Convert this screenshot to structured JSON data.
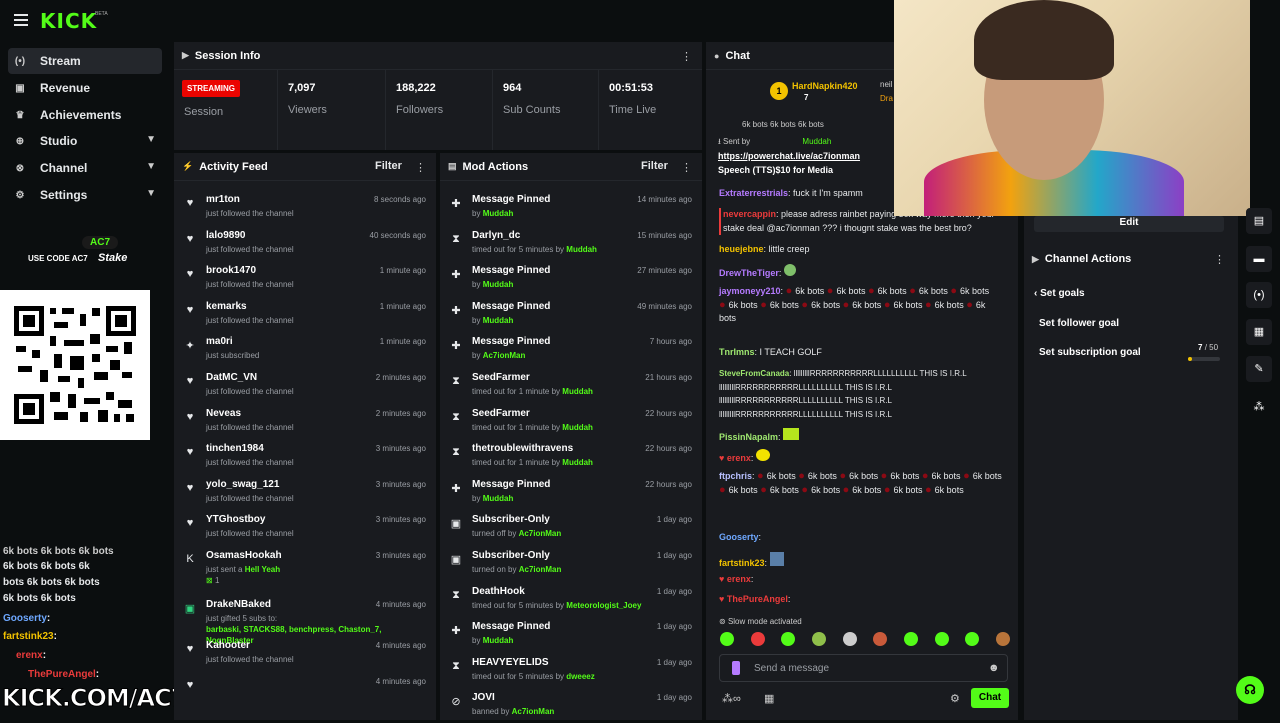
{
  "brand": {
    "logo": "KICK",
    "beta": "BETA"
  },
  "nav": [
    {
      "label": "Stream",
      "icon": "stream-icon"
    },
    {
      "label": "Revenue",
      "icon": "revenue-icon"
    },
    {
      "label": "Achievements",
      "icon": "trophy-icon"
    },
    {
      "label": "Studio",
      "icon": "studio-icon"
    },
    {
      "label": "Channel",
      "icon": "channel-icon"
    },
    {
      "label": "Settings",
      "icon": "gear-icon"
    }
  ],
  "promo": {
    "badge": "AC7",
    "code": "USE CODE AC7",
    "brand": "Stake"
  },
  "overlay_chat": {
    "lines": [
      {
        "text": "6k bots  6k bots  6k bots"
      },
      {
        "text": "6k bots  6k bots  6k"
      },
      {
        "text": "bots  6k bots  6k bots"
      },
      {
        "text": "6k bots  6k bots"
      },
      {
        "user": "Gooserty",
        "text": ":"
      },
      {
        "user": "fartstink23",
        "text": ":"
      },
      {
        "user": "erenx",
        "text": ":"
      },
      {
        "user": "ThePureAngel",
        "text": ":"
      }
    ],
    "url": "KICK.COM/AC7IONMAN"
  },
  "session": {
    "title": "Session Info",
    "badge": "STREAMING",
    "session_label": "Session",
    "stats": [
      {
        "value": "7,097",
        "label": "Viewers"
      },
      {
        "value": "188,222",
        "label": "Followers"
      },
      {
        "value": "964",
        "label": "Sub Counts"
      },
      {
        "value": "00:51:53",
        "label": "Time Live"
      }
    ]
  },
  "activity": {
    "title": "Activity Feed",
    "filter": "Filter",
    "items": [
      {
        "icon": "heart-icon",
        "name": "mr1ton",
        "sub": "just followed the channel",
        "time": "8 seconds ago"
      },
      {
        "icon": "heart-icon",
        "name": "lalo9890",
        "sub": "just followed the channel",
        "time": "40 seconds ago"
      },
      {
        "icon": "heart-icon",
        "name": "brook1470",
        "sub": "just followed the channel",
        "time": "1 minute ago"
      },
      {
        "icon": "heart-icon",
        "name": "kemarks",
        "sub": "just followed the channel",
        "time": "1 minute ago"
      },
      {
        "icon": "star-icon",
        "name": "ma0ri",
        "sub": "just subscribed",
        "time": "1 minute ago"
      },
      {
        "icon": "heart-icon",
        "name": "DatMC_VN",
        "sub": "just followed the channel",
        "time": "2 minutes ago"
      },
      {
        "icon": "heart-icon",
        "name": "Neveas",
        "sub": "just followed the channel",
        "time": "2 minutes ago"
      },
      {
        "icon": "heart-icon",
        "name": "tinchen1984",
        "sub": "just followed the channel",
        "time": "3 minutes ago"
      },
      {
        "icon": "heart-icon",
        "name": "yolo_swag_121",
        "sub": "just followed the channel",
        "time": "3 minutes ago"
      },
      {
        "icon": "heart-icon",
        "name": "YTGhostboy",
        "sub": "just followed the channel",
        "time": "3 minutes ago"
      },
      {
        "icon": "kick-icon",
        "name": "OsamasHookah",
        "sub": "just sent a",
        "sub_extra": "Hell Yeah",
        "sub2": "1",
        "time": "3 minutes ago"
      },
      {
        "icon": "gift-icon",
        "name": "DrakeNBaked",
        "sub": "just gifted 5 subs to:",
        "sub_list": "barbaski, STACKS88, benchpress, Chaston_7,",
        "sub_list2": "NognBlaster",
        "time": "4 minutes ago"
      },
      {
        "icon": "heart-icon",
        "name": "Kahooter",
        "sub": "just followed the channel",
        "time": "4 minutes ago"
      },
      {
        "icon": "heart-icon",
        "name": "",
        "sub": "",
        "time": "4 minutes ago"
      }
    ]
  },
  "mod": {
    "title": "Mod Actions",
    "filter": "Filter",
    "items": [
      {
        "icon": "pin-icon",
        "name": "Message Pinned",
        "pre": "by",
        "by": "Muddah",
        "time": "14 minutes ago"
      },
      {
        "icon": "hourglass-icon",
        "name": "Darlyn_dc",
        "pre": "timed out for 5 minutes by",
        "by": "Muddah",
        "time": "15 minutes ago"
      },
      {
        "icon": "pin-icon",
        "name": "Message Pinned",
        "pre": "by",
        "by": "Muddah",
        "time": "27 minutes ago"
      },
      {
        "icon": "pin-icon",
        "name": "Message Pinned",
        "pre": "by",
        "by": "Muddah",
        "time": "49 minutes ago"
      },
      {
        "icon": "pin-icon",
        "name": "Message Pinned",
        "pre": "by",
        "by": "Ac7ionMan",
        "time": "7 hours ago"
      },
      {
        "icon": "hourglass-icon",
        "name": "SeedFarmer",
        "pre": "timed out for 1 minute by",
        "by": "Muddah",
        "time": "21 hours ago"
      },
      {
        "icon": "hourglass-icon",
        "name": "SeedFarmer",
        "pre": "timed out for 1 minute by",
        "by": "Muddah",
        "time": "22 hours ago"
      },
      {
        "icon": "hourglass-icon",
        "name": "thetroublewithravens",
        "pre": "timed out for 1 minute by",
        "by": "Muddah",
        "time": "22 hours ago"
      },
      {
        "icon": "pin-icon",
        "name": "Message Pinned",
        "pre": "by",
        "by": "Muddah",
        "time": "22 hours ago"
      },
      {
        "icon": "gift-icon",
        "name": "Subscriber-Only",
        "pre": "turned off by",
        "by": "Ac7ionMan",
        "time": "1 day ago"
      },
      {
        "icon": "gift-icon",
        "name": "Subscriber-Only",
        "pre": "turned on by",
        "by": "Ac7ionMan",
        "time": "1 day ago"
      },
      {
        "icon": "hourglass-icon",
        "name": "DeathHook",
        "pre": "timed out for 5 minutes by",
        "by": "Meteorologist_Joey",
        "time": "1 day ago"
      },
      {
        "icon": "pin-icon",
        "name": "Message Pinned",
        "pre": "by",
        "by": "Muddah",
        "time": "1 day ago"
      },
      {
        "icon": "hourglass-icon",
        "name": "HEAVYEYELIDS",
        "pre": "timed out for 5 minutes by",
        "by": "dweeez",
        "time": "1 day ago"
      },
      {
        "icon": "ban-icon",
        "name": "JOVI",
        "pre": "banned by",
        "by": "Ac7ionMan",
        "time": "1 day ago"
      }
    ]
  },
  "chat": {
    "title": "Chat",
    "top_gifter": {
      "name": "HardNapkin420",
      "count": "7",
      "rank": "1"
    },
    "top_gifter2": "neil",
    "top_gifter3": "Dra",
    "pinned": {
      "header_bots": "6k bots   6k bots   6k bots",
      "sent_by_label": "Sent by",
      "sent_by": "Muddah",
      "link": "https://powerchat.live/ac7ionman",
      "line2": "Speech (TTS)$10 for Media"
    },
    "messages": [
      {
        "user": "Extraterrestrials",
        "color": "#b57bff",
        "text": ": fuck it I'm spamm"
      },
      {
        "user": "nevercappin",
        "color": "#eb3b3b",
        "text": ": please adress rainbet paying 50x way more then your stake deal @ac7ionman ??? i thougnt stake was the best bro?"
      },
      {
        "user": "heuejebne",
        "color": "#f2c200",
        "text": ": little creep"
      },
      {
        "user": "DrewTheTiger",
        "color": "#b57bff",
        "text": ":"
      },
      {
        "user": "jaymoneyy210",
        "color": "#b57bff",
        "text": ":",
        "bots": "6k bots"
      },
      {
        "user": "TnrImns",
        "color": "#9fe870",
        "text": ": I TEACH GOLF"
      },
      {
        "user": "SteveFromCanada",
        "color": "#9fe870",
        "text": ": lllllllllRRRRRRRRRRRLLLLLLLLLL THIS IS I.R.L lllllllllRRRRRRRRRRRLLLLLLLLLL THIS IS I.R.L lllllllllRRRRRRRRRRRLLLLLLLLLL THIS IS I.R.L lllllllllRRRRRRRRRRRLLLLLLLLLL THIS IS I.R.L"
      },
      {
        "user": "PissinNapalm",
        "color": "#9fe870",
        "text": ":"
      },
      {
        "user": "erenx",
        "color": "#eb3b3b",
        "text": ":"
      },
      {
        "user": "ftpchris",
        "color": "#b8c0ff",
        "text": ":",
        "bots": "6k bots"
      },
      {
        "user": "Gooserty",
        "color": "#6ea8ff",
        "text": ":"
      },
      {
        "user": "fartstink23",
        "color": "#f2c200",
        "text": ":"
      },
      {
        "user": "erenx",
        "color": "#eb3b3b",
        "text": ":"
      },
      {
        "user": "ThePureAngel",
        "color": "#eb3b3b",
        "text": ":"
      }
    ],
    "slow_mode": "Slow mode activated",
    "input_placeholder": "Send a message",
    "send_label": "Chat"
  },
  "actions": {
    "edit": "Edit",
    "title": "Channel Actions",
    "back": "Set goals",
    "items": [
      "Set follower goal",
      "Set subscription goal"
    ],
    "goal_value": "7",
    "goal_total": "/ 50",
    "goal_fraction": 0.14
  },
  "colors": {
    "accent": "#53fc18",
    "live": "#eb0400",
    "panel": "#191b1f",
    "bg": "#0b0e0f"
  }
}
